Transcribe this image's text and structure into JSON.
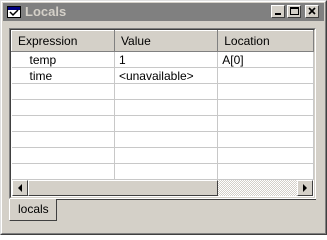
{
  "window": {
    "title": "Locals",
    "title_icon": "locals-window-icon",
    "buttons": [
      "minimize-icon",
      "maximize-icon",
      "close-icon"
    ]
  },
  "table": {
    "columns": [
      "Expression",
      "Value",
      "Location"
    ],
    "rows": [
      {
        "expression": "temp",
        "value": "1",
        "location": "A[0]"
      },
      {
        "expression": "time",
        "value": "<unavailable>",
        "location": ""
      }
    ]
  },
  "tabs": [
    {
      "label": "locals",
      "active": true
    }
  ],
  "colors": {
    "titlebar_inactive": "#808080",
    "face": "#d4d0c8",
    "title_text": "#d4d0c8"
  }
}
